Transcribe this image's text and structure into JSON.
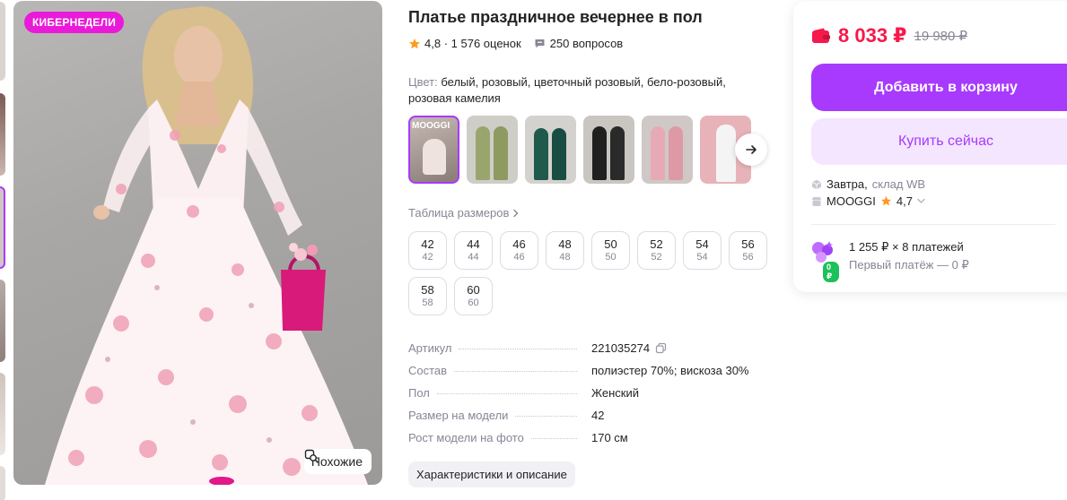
{
  "gallery": {
    "promo_badge": "КИБЕРНЕДЕЛИ",
    "similar_label": "Похожие"
  },
  "product": {
    "title": "Платье праздничное вечернее в пол",
    "rating": "4,8",
    "reviews": "1 576 оценок",
    "questions": "250 вопросов",
    "color_label": "Цвет:",
    "color_value": "белый, розовый, цветочный розовый, бело-розовый, розовая камелия",
    "variant_brand_text": "MOOGGI",
    "size_table_label": "Таблица размеров",
    "sizes": [
      {
        "size": "42",
        "ru": "42"
      },
      {
        "size": "44",
        "ru": "44"
      },
      {
        "size": "46",
        "ru": "46"
      },
      {
        "size": "48",
        "ru": "48"
      },
      {
        "size": "50",
        "ru": "50"
      },
      {
        "size": "52",
        "ru": "52"
      },
      {
        "size": "54",
        "ru": "54"
      },
      {
        "size": "56",
        "ru": "56"
      },
      {
        "size": "58",
        "ru": "58"
      },
      {
        "size": "60",
        "ru": "60"
      }
    ],
    "specs": [
      {
        "key": "Артикул",
        "value": "221035274"
      },
      {
        "key": "Состав",
        "value": "полиэстер 70%; вискоза 30%"
      },
      {
        "key": "Пол",
        "value": "Женский"
      },
      {
        "key": "Размер на модели",
        "value": "42"
      },
      {
        "key": "Рост модели на фото",
        "value": "170 см"
      }
    ],
    "characteristics_button": "Характеристики и описание"
  },
  "buy_card": {
    "price": "8 033 ₽",
    "old_price": "19 980 ₽",
    "add_to_cart": "Добавить в корзину",
    "buy_now": "Купить сейчас",
    "delivery_day": "Завтра,",
    "delivery_warehouse": "склад WB",
    "seller_name": "MOOGGI",
    "seller_rating": "4,7",
    "installment_main": "1 255 ₽ × 8 платежей",
    "installment_first": "Первый платёж — 0 ₽",
    "installment_badge": "0 ₽"
  },
  "colors": {
    "accent": "#a73afd",
    "price": "#f5194c",
    "promo": "#e91bd8",
    "star": "#ff9a1f",
    "muted": "#868695"
  }
}
